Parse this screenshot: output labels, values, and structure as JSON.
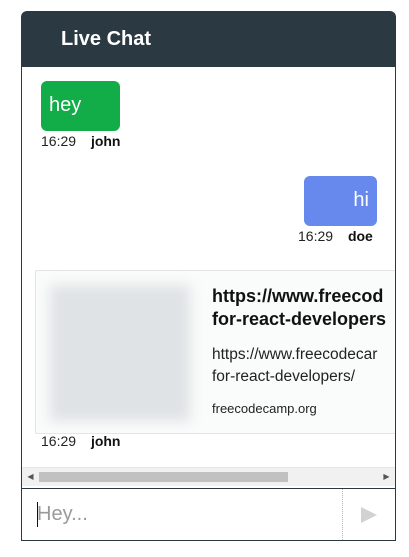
{
  "header": {
    "title": "Live Chat"
  },
  "messages": [
    {
      "text": "hey",
      "time": "16:29",
      "user": "john"
    },
    {
      "text": "hi",
      "time": "16:29",
      "user": "doe"
    },
    {
      "link_preview": {
        "title_line1": "https://www.freecod",
        "title_line2": "for-react-developers",
        "desc_line1": "https://www.freecodecar",
        "desc_line2": "for-react-developers/",
        "domain": "freecodecamp.org"
      },
      "time": "16:29",
      "user": "john"
    }
  ],
  "composer": {
    "placeholder": "Hey..."
  },
  "colors": {
    "header_bg": "#2b3a42",
    "received_bubble": "#12ac49",
    "sent_bubble": "#6788ec"
  },
  "icons": {
    "send": "send-triangle-icon"
  }
}
